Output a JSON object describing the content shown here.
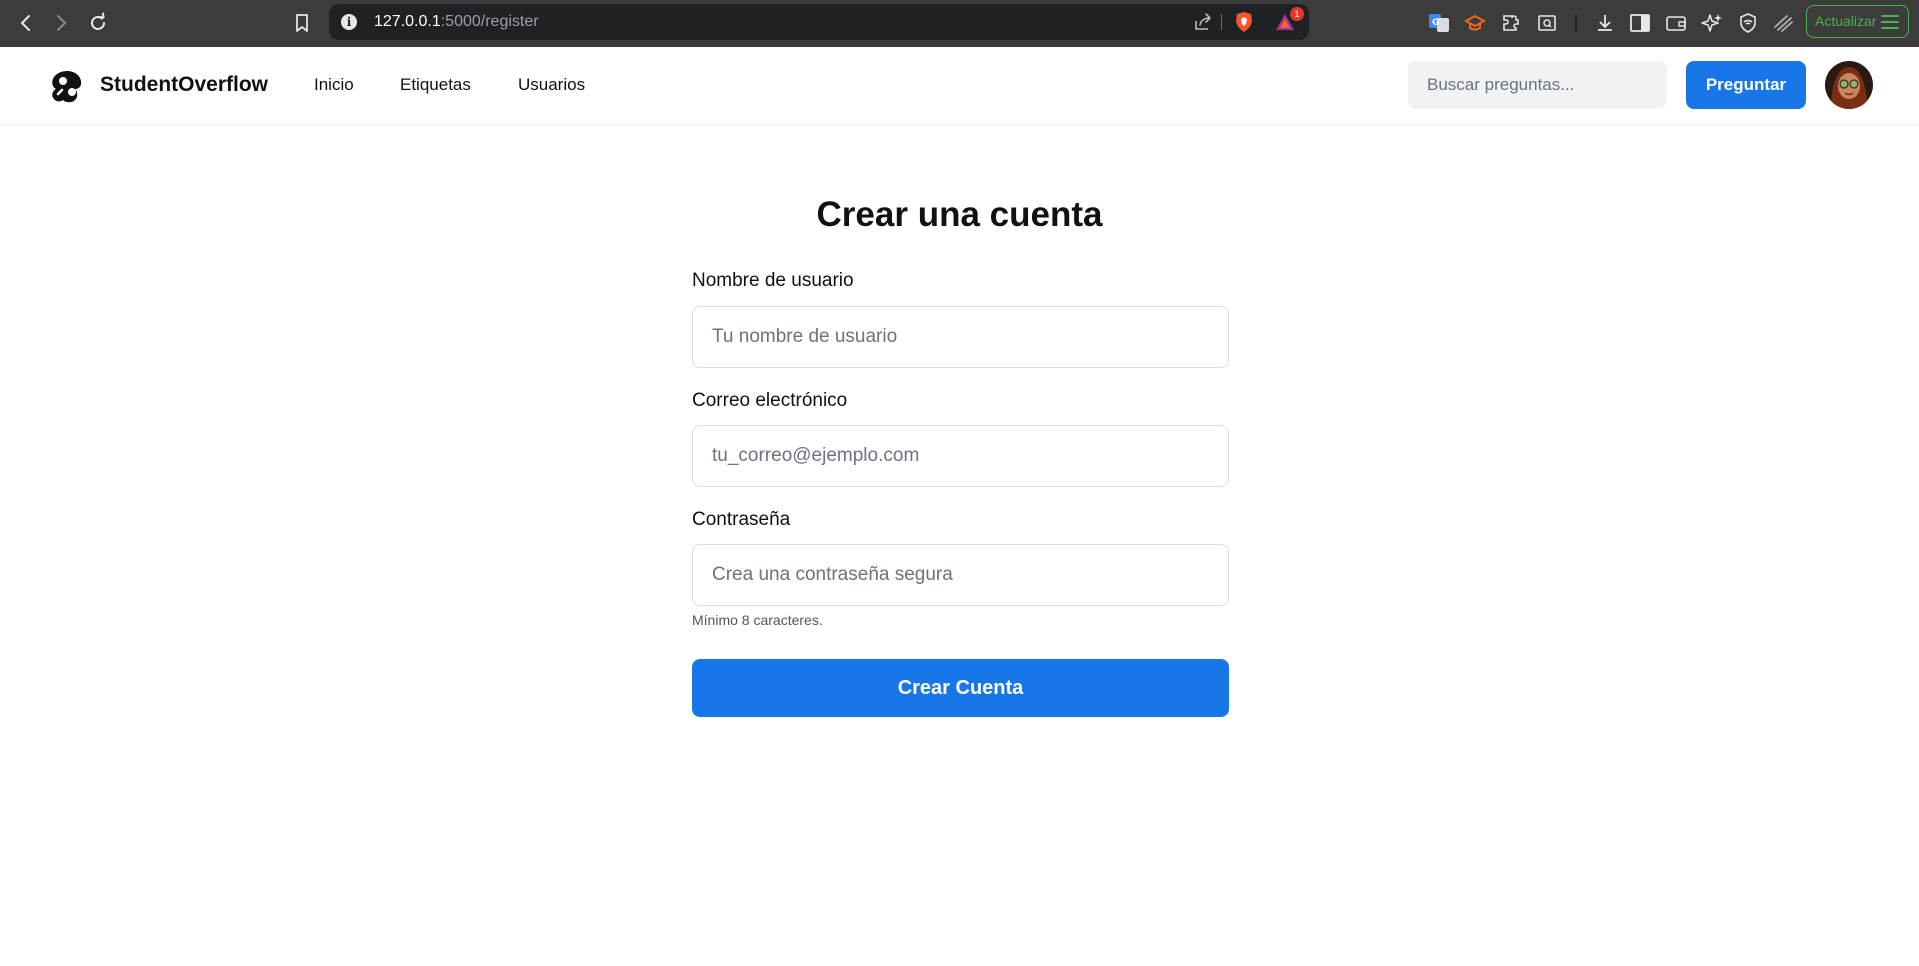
{
  "browser": {
    "url_host": "127.0.0.1",
    "url_path": ":5000/register",
    "update_label": "Actualizar",
    "notification_count": "1"
  },
  "header": {
    "brand": "StudentOverflow",
    "nav": [
      {
        "label": "Inicio"
      },
      {
        "label": "Etiquetas"
      },
      {
        "label": "Usuarios"
      }
    ],
    "search_placeholder": "Buscar preguntas...",
    "ask_label": "Preguntar"
  },
  "form": {
    "title": "Crear una cuenta",
    "username": {
      "label": "Nombre de usuario",
      "placeholder": "Tu nombre de usuario",
      "value": ""
    },
    "email": {
      "label": "Correo electrónico",
      "placeholder": "tu_correo@ejemplo.com",
      "value": ""
    },
    "password": {
      "label": "Contraseña",
      "placeholder": "Crea una contraseña segura",
      "value": "",
      "hint": "Mínimo 8 caracteres."
    },
    "submit_label": "Crear Cuenta"
  },
  "colors": {
    "accent": "#1877e8",
    "chrome_bg": "#3c3c3c",
    "update_green": "#4caf50"
  }
}
